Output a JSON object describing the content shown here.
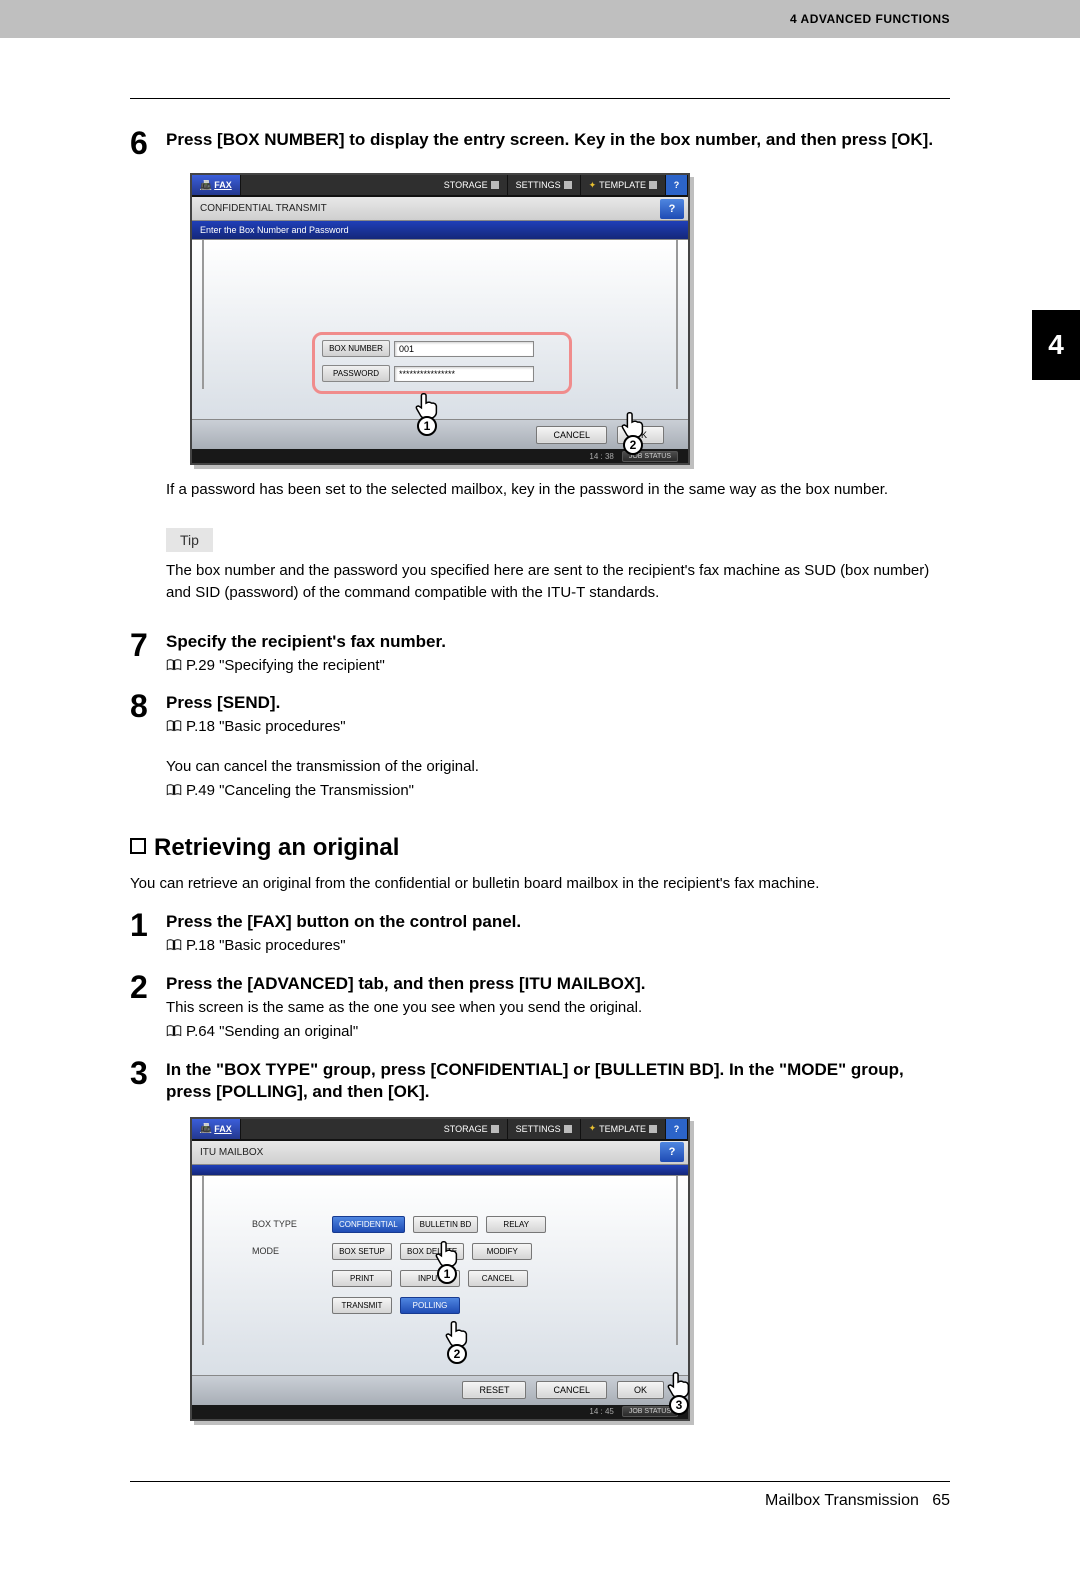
{
  "header": {
    "chapter": "4 ADVANCED FUNCTIONS"
  },
  "chapter_tab": "4",
  "step6": {
    "num": "6",
    "title": "Press [BOX NUMBER] to display the entry screen. Key in the box number, and then press [OK].",
    "after_text": "If a password has been set to the selected mailbox, key in the password in the same way as the box number.",
    "tip_label": "Tip",
    "tip_text": "The box number and the password you specified here are sent to the recipient's fax machine as SUD (box number) and SID (password) of the command compatible with the ITU-T standards.",
    "ui": {
      "fax_tab": "FAX",
      "storage_tab": "STORAGE",
      "settings_tab": "SETTINGS",
      "template_tab": "TEMPLATE",
      "help": "?",
      "subtitle": "CONFIDENTIAL TRANSMIT",
      "bluemsg": "Enter the Box Number and Password",
      "boxnum_label": "BOX NUMBER",
      "boxnum_value": "001",
      "password_label": "PASSWORD",
      "password_value": "****************",
      "cancel_btn": "CANCEL",
      "ok_btn": "OK",
      "time": "14 : 38",
      "status_btn": "JOB STATUS",
      "call1": "1",
      "call2": "2"
    }
  },
  "step7": {
    "num": "7",
    "title": "Specify the recipient's fax number.",
    "ref": "P.29 \"Specifying the recipient\""
  },
  "step8": {
    "num": "8",
    "title": "Press [SEND].",
    "ref1": "P.18 \"Basic procedures\"",
    "cancel_note": "You can cancel the transmission of the original.",
    "ref2": "P.49 \"Canceling the Transmission\""
  },
  "section": {
    "heading": "Retrieving an original",
    "intro": "You can retrieve an original from the confidential or bulletin board mailbox in the recipient's fax machine."
  },
  "r_step1": {
    "num": "1",
    "title": "Press the [FAX] button on the control panel.",
    "ref": "P.18 \"Basic procedures\""
  },
  "r_step2": {
    "num": "2",
    "title": "Press the [ADVANCED] tab, and then press [ITU MAILBOX].",
    "note": "This screen is the same as the one you see when you send the original.",
    "ref": "P.64 \"Sending an original\""
  },
  "r_step3": {
    "num": "3",
    "title": "In the \"BOX TYPE\" group, press [CONFIDENTIAL] or [BULLETIN BD]. In the \"MODE\" group, press [POLLING], and then [OK].",
    "ui": {
      "fax_tab": "FAX",
      "storage_tab": "STORAGE",
      "settings_tab": "SETTINGS",
      "template_tab": "TEMPLATE",
      "help": "?",
      "subtitle": "ITU MAILBOX",
      "row1_label": "BOX TYPE",
      "row2_label": "MODE",
      "btn_confidential": "CONFIDENTIAL",
      "btn_bulletin": "BULLETIN BD",
      "btn_relay": "RELAY",
      "btn_boxsetup": "BOX SETUP",
      "btn_boxdelete": "BOX DELETE",
      "btn_modify": "MODIFY",
      "btn_print": "PRINT",
      "btn_input": "INPUT",
      "btn_cancel_s": "CANCEL",
      "btn_transmit": "TRANSMIT",
      "btn_polling": "POLLING",
      "reset_btn": "RESET",
      "cancel_btn": "CANCEL",
      "ok_btn": "OK",
      "time": "14 : 45",
      "status_btn": "JOB STATUS",
      "call1": "1",
      "call2": "2",
      "call3": "3"
    }
  },
  "footer": {
    "section": "Mailbox Transmission",
    "page": "65"
  }
}
